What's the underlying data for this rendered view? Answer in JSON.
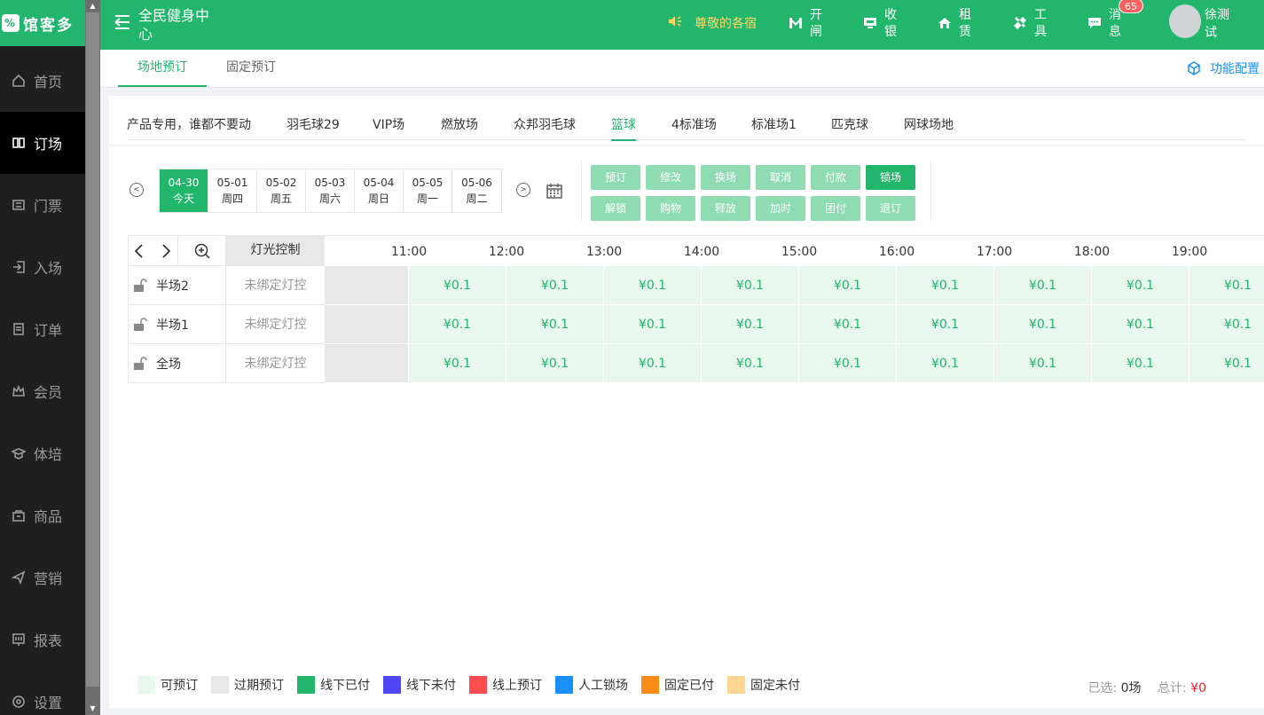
{
  "brand": {
    "logo_text": "馆客多",
    "logo_mark": "%"
  },
  "sidebar": {
    "items": [
      {
        "label": "首页",
        "icon": "home-icon"
      },
      {
        "label": "订场",
        "icon": "booking-icon"
      },
      {
        "label": "门票",
        "icon": "ticket-icon"
      },
      {
        "label": "入场",
        "icon": "entry-icon"
      },
      {
        "label": "订单",
        "icon": "order-icon"
      },
      {
        "label": "会员",
        "icon": "member-icon"
      },
      {
        "label": "体培",
        "icon": "training-icon"
      },
      {
        "label": "商品",
        "icon": "goods-icon"
      },
      {
        "label": "营销",
        "icon": "marketing-icon"
      },
      {
        "label": "报表",
        "icon": "report-icon"
      },
      {
        "label": "设置",
        "icon": "settings-icon"
      }
    ]
  },
  "header": {
    "title": "全民健身中心",
    "greeting": "尊敬的各宿",
    "actions": [
      {
        "label": "开闸",
        "icon": "gate-icon"
      },
      {
        "label": "收银",
        "icon": "cashier-icon"
      },
      {
        "label": "租赁",
        "icon": "rent-icon"
      },
      {
        "label": "工具",
        "icon": "tools-icon"
      },
      {
        "label": "消息",
        "icon": "message-icon"
      }
    ],
    "message_count": "65",
    "user_name": "徐测试"
  },
  "top_tabs": {
    "venue_booking": "场地预订",
    "fixed_booking": "固定预订",
    "func_config": "功能配置"
  },
  "venue_tabs": [
    "产品专用，谁都不要动",
    "羽毛球29",
    "VIP场",
    "燃放场",
    "众邦羽毛球",
    "篮球",
    "4标准场",
    "标准场1",
    "匹克球",
    "网球场地"
  ],
  "active_venue": "篮球",
  "dates": [
    {
      "date": "04-30",
      "day": "今天"
    },
    {
      "date": "05-01",
      "day": "周四"
    },
    {
      "date": "05-02",
      "day": "周五"
    },
    {
      "date": "05-03",
      "day": "周六"
    },
    {
      "date": "05-04",
      "day": "周日"
    },
    {
      "date": "05-05",
      "day": "周一"
    },
    {
      "date": "05-06",
      "day": "周二"
    }
  ],
  "operations": {
    "row1": [
      "预订",
      "修改",
      "换场",
      "取消",
      "付款",
      "锁场"
    ],
    "row2": [
      "解锁",
      "购物",
      "释放",
      "加时",
      "团付",
      "退订"
    ]
  },
  "grid": {
    "light_header": "灯光控制",
    "times": [
      "11:00",
      "12:00",
      "13:00",
      "14:00",
      "15:00",
      "16:00",
      "17:00",
      "18:00",
      "19:00"
    ],
    "rows": [
      {
        "name": "半场2",
        "light": "未绑定灯控"
      },
      {
        "name": "半场1",
        "light": "未绑定灯控"
      },
      {
        "name": "全场",
        "light": "未绑定灯控"
      }
    ],
    "price": "¥0.1"
  },
  "legend": [
    {
      "label": "可预订",
      "color": "#e8f8ee"
    },
    {
      "label": "过期预订",
      "color": "#e8e8e8"
    },
    {
      "label": "线下已付",
      "color": "#21b66c"
    },
    {
      "label": "线下未付",
      "color": "#5046f5"
    },
    {
      "label": "线上预订",
      "color": "#ff4d4f"
    },
    {
      "label": "人工锁场",
      "color": "#1890ff"
    },
    {
      "label": "固定已付",
      "color": "#fa8c16"
    },
    {
      "label": "固定未付",
      "color": "#ffd591"
    }
  ],
  "totals": {
    "selected_label": "已选:",
    "selected_value": "0场",
    "total_label": "总计:",
    "total_value": "¥0"
  },
  "colors": {
    "accent": "#21b66c",
    "sidebar_bg": "#1f1f1f"
  }
}
